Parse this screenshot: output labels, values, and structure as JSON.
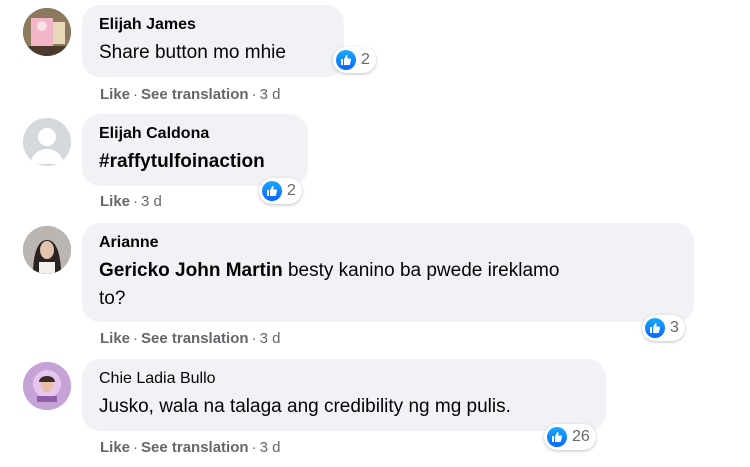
{
  "comments": [
    {
      "author": "Elijah James",
      "text": "Share button mo mhie",
      "reactions": "2",
      "actions": {
        "like": "Like",
        "translate": "See translation",
        "time": "3 d"
      }
    },
    {
      "author": "Elijah Caldona",
      "text": "#raffytulfoinaction",
      "reactions": "2",
      "actions": {
        "like": "Like",
        "time": "3 d"
      }
    },
    {
      "author": "Arianne",
      "mention": "Gericko John Martin",
      "text_line1": " besty kanino ba pwede ireklamo",
      "text_line2": "to?",
      "reactions": "3",
      "actions": {
        "like": "Like",
        "translate": "See translation",
        "time": "3 d"
      }
    },
    {
      "author": "Chie Ladia Bullo",
      "text": "Jusko, wala na talaga ang credibility ng mg pulis.",
      "reactions": "26",
      "actions": {
        "like": "Like",
        "translate": "See translation",
        "time": "3 d"
      }
    }
  ],
  "separator": "·",
  "colors": {
    "bubble": "#f0f2f5",
    "like_blue": "#0866ff",
    "meta_gray": "#65676b"
  }
}
